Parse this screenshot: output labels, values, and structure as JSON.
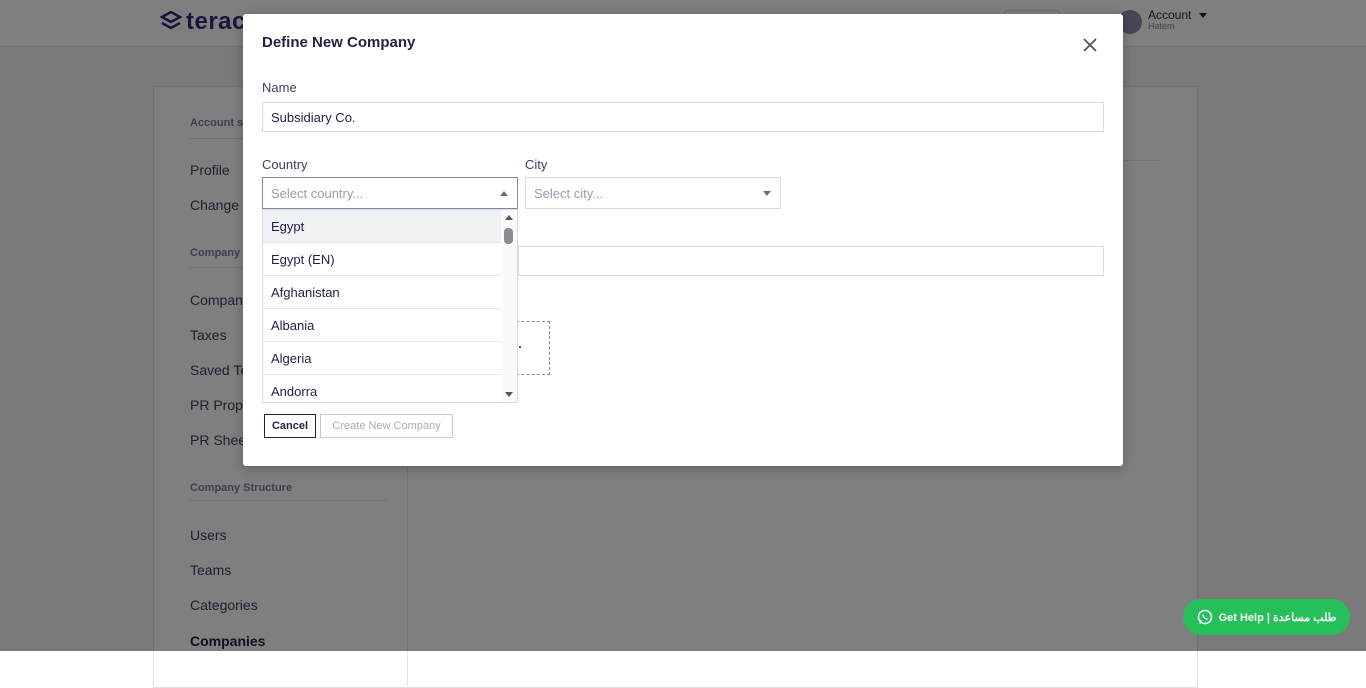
{
  "app": {
    "logo_text": "terac",
    "account_label": "Account",
    "account_sub": "Hatem"
  },
  "sidebar": {
    "sections": [
      {
        "title": "Account s",
        "items": [
          "Profile",
          "Change P"
        ]
      },
      {
        "title": "Company",
        "items": [
          "Compan",
          "Taxes",
          "Saved Te",
          "PR Prope",
          "PR Sheet"
        ]
      },
      {
        "title": "Company Structure",
        "items": [
          "Users",
          "Teams",
          "Categories",
          "Companies"
        ]
      }
    ],
    "active_item": "Companies"
  },
  "modal": {
    "title": "Define New Company",
    "name_label": "Name",
    "name_value": "Subsidiary Co.",
    "country_label": "Country",
    "country_placeholder": "Select country...",
    "city_label": "City",
    "city_placeholder": "Select city...",
    "country_options": [
      "Egypt",
      "Egypt (EN)",
      "Afghanistan",
      "Albania",
      "Algeria",
      "Andorra"
    ],
    "cancel_label": "Cancel",
    "create_label": "Create New Company"
  },
  "help": {
    "label": "Get Help | طلب مساعدة"
  },
  "colors": {
    "brand": "#2a2f7a",
    "help_green": "#25c05a"
  }
}
